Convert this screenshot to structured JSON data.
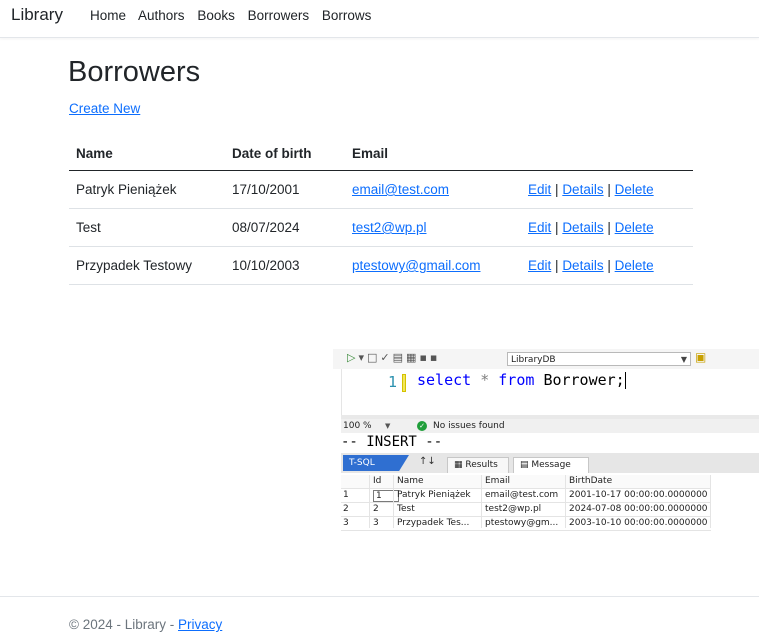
{
  "navbar": {
    "brand": "Library",
    "links": [
      "Home",
      "Authors",
      "Books",
      "Borrowers",
      "Borrows"
    ]
  },
  "main": {
    "title": "Borrowers",
    "create_label": "Create New",
    "columns": [
      "Name",
      "Date of birth",
      "Email"
    ],
    "rows": [
      {
        "name": "Patryk Pieniążek",
        "dob": "17/10/2001",
        "email": "email@test.com"
      },
      {
        "name": "Test",
        "dob": "08/07/2024",
        "email": "test2@wp.pl"
      },
      {
        "name": "Przypadek Testowy",
        "dob": "10/10/2003",
        "email": "ptestowy@gmail.com"
      }
    ],
    "actions": {
      "edit": "Edit",
      "details": "Details",
      "delete": "Delete",
      "separator": "|"
    }
  },
  "ssms": {
    "database": "LibraryDB",
    "line_number": "1",
    "code": {
      "kw1": "select",
      "op": "*",
      "kw2": "from",
      "table": "Borrower;"
    },
    "zoom": "100 %",
    "issues": "No issues found",
    "mode_line": "-- INSERT --",
    "tabs": {
      "tsql": "T-SQL",
      "results": "Results",
      "message": "Message"
    },
    "grid": {
      "columns": [
        "Id",
        "Name",
        "Email",
        "BirthDate"
      ],
      "rows": [
        {
          "idx": "1",
          "id": "1",
          "name": "Patryk Pieniążek",
          "email": "email@test.com",
          "birth": "2001-10-17 00:00:00.0000000"
        },
        {
          "idx": "2",
          "id": "2",
          "name": "Test",
          "email": "test2@wp.pl",
          "birth": "2024-07-08 00:00:00.0000000"
        },
        {
          "idx": "3",
          "id": "3",
          "name": "Przypadek Tes...",
          "email": "ptestowy@gm...",
          "birth": "2003-10-10 00:00:00.0000000"
        }
      ]
    }
  },
  "footer": {
    "text": "© 2024 - Library - ",
    "privacy": "Privacy"
  }
}
